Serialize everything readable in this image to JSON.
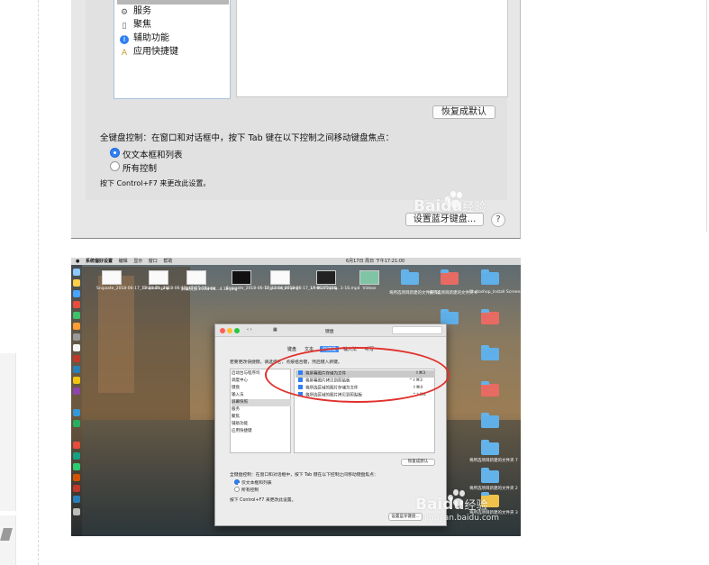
{
  "keyboard_panel": {
    "categories": [
      {
        "label": "服务",
        "icon": "gear-icon"
      },
      {
        "label": "聚焦",
        "icon": "spotlight-icon"
      },
      {
        "label": "辅助功能",
        "icon": "accessibility-icon"
      },
      {
        "label": "应用快捷键",
        "icon": "app-shortcuts-icon"
      }
    ],
    "restore_defaults": "恢复成默认",
    "full_keyboard_label": "全键盘控制：在窗口和对话框中，按下 Tab 键在以下控制之间移动键盘焦点：",
    "radio_text_lists": "仅文本框和列表",
    "radio_all_controls": "所有控制",
    "hint": "按下 Control+F7 来更改此设置。",
    "bluetooth_button": "设置蓝牙键盘...",
    "help_symbol": "?"
  },
  "watermark": {
    "brand": "Bai",
    "mid": "du",
    "tail": "经验",
    "url": "jingyan.baidu.com"
  },
  "desktop": {
    "menubar_items": [
      "系统偏好设置",
      "编辑",
      "显示",
      "窗口",
      "帮助"
    ],
    "clock": "6月17日 周日 下午17:21:00",
    "window_title": "键盘",
    "tabs": [
      "键盘",
      "文本",
      "快捷键",
      "输入法",
      "听写"
    ],
    "active_tab": "快捷键",
    "instruction": "若要更改快捷键，请选择它，点按组合键，然后键入新键。",
    "sidebar_items": [
      "启动台与程序坞",
      "调度中心",
      "键盘",
      "输入法",
      "屏幕快照",
      "服务",
      "聚焦",
      "辅助功能",
      "应用快捷键"
    ],
    "shortcuts": [
      {
        "label": "将屏幕图片存储为文件",
        "key": "⇧⌘3"
      },
      {
        "label": "将屏幕图片拷贝到剪贴板",
        "key": "^⇧⌘3"
      },
      {
        "label": "将所选区域的图片存储为文件",
        "key": "⇧⌘4"
      },
      {
        "label": "将所选区域的图片拷贝到剪贴板",
        "key": "^⇧⌘4"
      }
    ],
    "restore_defaults": "恢复成默认",
    "full_keyboard_label": "全键盘控制：在窗口和对话框中，按下 Tab 键在以下控制之间移动键盘焦点：",
    "radio_text_lists": "仅文本框和列表",
    "radio_all_controls": "所有控制",
    "hint": "按下 Control+F7 来更改此设置。",
    "bluetooth_button": "设置蓝牙键盘...",
    "files": [
      {
        "name": "Snipaste_2018-06-17_17-20-21.png"
      },
      {
        "name": "Snipaste_2018-06-17_17-15-18.png"
      },
      {
        "name": "屏幕快照 2018-06...4.38.png"
      },
      {
        "name": "Snipaste_2018-06-17_17-16-00.png"
      },
      {
        "name": "Snipaste_2018-06-17_17-06-05.png"
      },
      {
        "name": "vn-8 273016...1-16.mp4"
      },
      {
        "name": "Videos"
      }
    ],
    "folders": [
      {
        "name": "将所选项目新建的文件夹 10"
      },
      {
        "name": "将所选项目新建的文件夹 4"
      },
      {
        "name": "Photoshop_Install Screenshot 2018-06-17 (Start).jpg"
      },
      {
        "name": "将所选项目新建的文件夹 7"
      },
      {
        "name": "将所选项目新建的文件夹 2"
      },
      {
        "name": "将所选项目新建的文件夹 3"
      }
    ]
  }
}
